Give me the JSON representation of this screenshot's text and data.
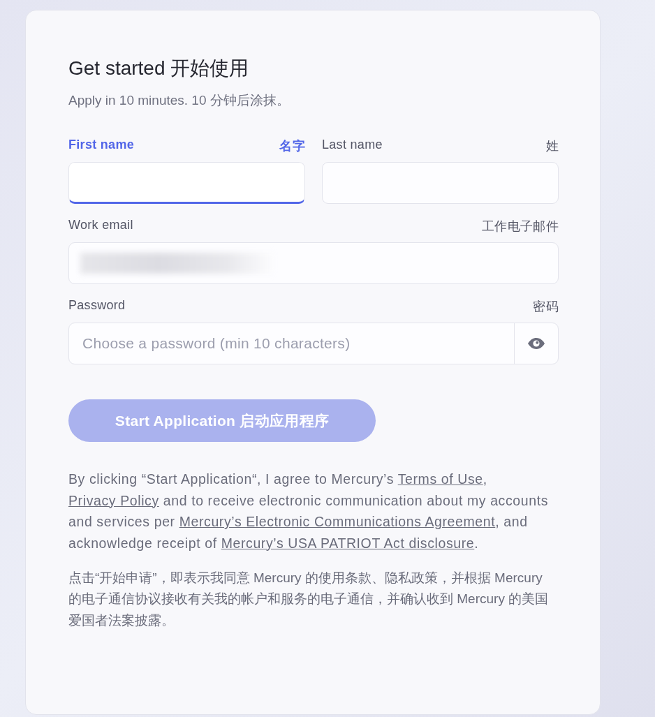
{
  "title": "Get started 开始使用",
  "subtitle": "Apply in 10 minutes. 10 分钟后涂抹。",
  "fields": [
    {
      "kind": "text",
      "label": "First name",
      "label_zh": "名字",
      "focused": true
    },
    {
      "kind": "text",
      "label": "Last name",
      "label_zh": "姓",
      "focused": false
    },
    {
      "kind": "redacted",
      "label": "Work email",
      "label_zh": "工作电子邮件",
      "focused": false
    },
    {
      "kind": "password",
      "label": "Password",
      "label_zh": "密码",
      "focused": false,
      "placeholder": "Choose a password (min 10 characters)"
    }
  ],
  "submit": {
    "label": "Start Application 启动应用程序",
    "disabled": true
  },
  "legal": [
    {
      "kind": "text",
      "text": "By clicking “Start Application“, I agree to Mercury’s "
    },
    {
      "kind": "link",
      "text": "Terms of Use"
    },
    {
      "kind": "text",
      "text": ", "
    },
    {
      "kind": "link",
      "text": "Privacy Policy"
    },
    {
      "kind": "text",
      "text": " and to receive electronic communication about my accounts and services per "
    },
    {
      "kind": "link",
      "text": "Mercury’s Electronic Communications Agreement"
    },
    {
      "kind": "text",
      "text": ", and acknowledge receipt of "
    },
    {
      "kind": "link",
      "text": "Mercury’s USA PATRIOT Act disclosure"
    },
    {
      "kind": "text",
      "text": "."
    }
  ],
  "legal_zh": "点击“开始申请”，即表示我同意 Mercury 的使用条款、隐私政策，并根据 Mercury 的电子通信协议接收有关我的帐户和服务的电子通信，并确认收到 Mercury 的美国爱国者法案披露。"
}
